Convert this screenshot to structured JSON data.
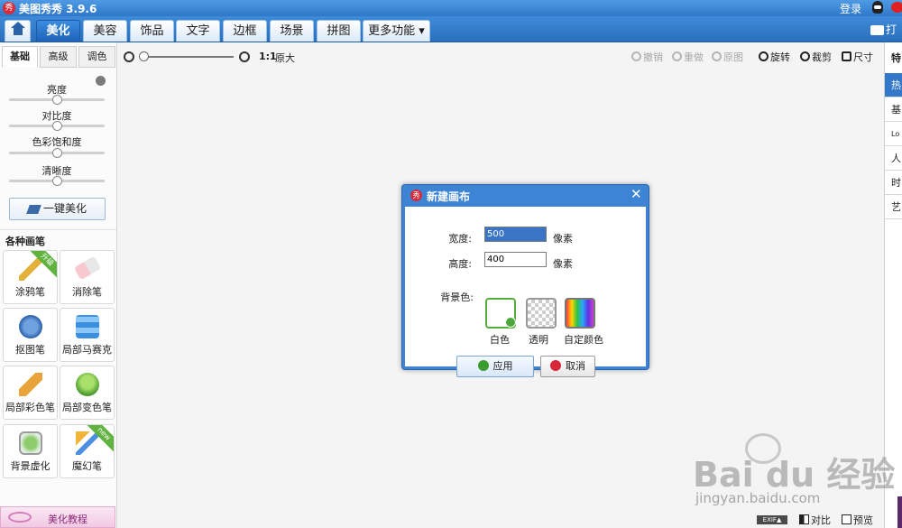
{
  "app": {
    "title": "美图秀秀 3.9.6",
    "logo_char": "秀",
    "login": "登录"
  },
  "nav": {
    "tabs": [
      "美化",
      "美容",
      "饰品",
      "文字",
      "边框",
      "场景",
      "拼图",
      "更多功能 ▾"
    ],
    "active_tab": "美化",
    "open_label": "打"
  },
  "left": {
    "subtabs": [
      "基础",
      "高级",
      "调色"
    ],
    "adjust_sliders": [
      {
        "label": "亮度",
        "value": 0.5
      },
      {
        "label": "对比度",
        "value": 0.5
      },
      {
        "label": "色彩饱和度",
        "value": 0.5
      },
      {
        "label": "清晰度",
        "value": 0.5
      }
    ],
    "one_key": "一键美化",
    "brushes_title": "各种画笔",
    "brushes": [
      {
        "label": "涂鸦笔",
        "ribbon": "升级",
        "icon": "crayon-icon"
      },
      {
        "label": "消除笔",
        "ribbon": "",
        "icon": "eraser-icon"
      },
      {
        "label": "抠图笔",
        "ribbon": "",
        "icon": "cutout-pen-icon"
      },
      {
        "label": "局部马赛克",
        "ribbon": "",
        "icon": "mosaic-icon"
      },
      {
        "label": "局部彩色笔",
        "ribbon": "",
        "icon": "color-brush-icon"
      },
      {
        "label": "局部变色笔",
        "ribbon": "",
        "icon": "paint-bucket-icon"
      },
      {
        "label": "背景虚化",
        "ribbon": "",
        "icon": "blur-icon"
      },
      {
        "label": "魔幻笔",
        "ribbon": "new",
        "icon": "magic-wand-icon"
      }
    ],
    "tutorial": "美化教程"
  },
  "toolbar": {
    "zoom_level": 0,
    "zoom_ratio": "1:1",
    "zoom_actual": "原大",
    "undo": "撤销",
    "redo": "重做",
    "original": "原图",
    "rotate": "旋转",
    "crop": "裁剪",
    "resize": "尺寸"
  },
  "right": {
    "header": "特",
    "items": [
      "热",
      "基",
      "Lo",
      "人",
      "时",
      "艺"
    ]
  },
  "dialog": {
    "title": "新建画布",
    "width_label": "宽度:",
    "width_value": "500",
    "height_label": "高度:",
    "height_value": "400",
    "unit": "像素",
    "bg_label": "背景色:",
    "colors": [
      "白色",
      "透明",
      "自定颜色"
    ],
    "ok": "应用",
    "cancel": "取消"
  },
  "status": {
    "exif": "EXIF▲",
    "compare": "对比",
    "preview": "预览"
  },
  "watermark": {
    "main": "Bai du 经验",
    "sub": "jingyan.baidu.com"
  },
  "colors": {
    "accent": "#2f78c9",
    "nav_active": "#1d62b8",
    "dialog_frame": "#3d85d4",
    "selected": "#3a74c5"
  }
}
